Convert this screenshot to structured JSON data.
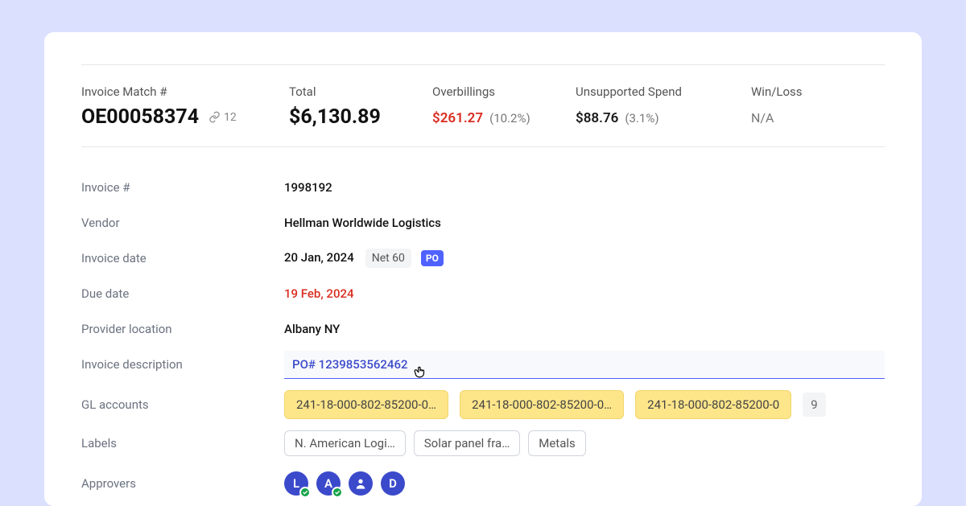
{
  "summary": {
    "match_label": "Invoice Match #",
    "match_number": "OE00058374",
    "match_link_count": "12",
    "total_label": "Total",
    "total_value": "$6,130.89",
    "overbill_label": "Overbillings",
    "overbill_value": "$261.27",
    "overbill_pct": "(10.2%)",
    "unsupported_label": "Unsupported Spend",
    "unsupported_value": "$88.76",
    "unsupported_pct": "(3.1%)",
    "winloss_label": "Win/Loss",
    "winloss_value": "N/A"
  },
  "details": {
    "invoice_num_label": "Invoice #",
    "invoice_num": "1998192",
    "vendor_label": "Vendor",
    "vendor": "Hellman Worldwide Logistics",
    "inv_date_label": "Invoice date",
    "inv_date": "20 Jan, 2024",
    "net_terms": "Net 60",
    "po_tag": "PO",
    "due_label": "Due date",
    "due_date": "19 Feb, 2024",
    "provider_label": "Provider location",
    "provider": "Albany NY",
    "desc_label": "Invoice description",
    "desc_link": "PO# 1239853562462",
    "gl_label": "GL accounts",
    "gl": [
      "241-18-000-802-85200-0…",
      "241-18-000-802-85200-0…",
      "241-18-000-802-85200-0"
    ],
    "gl_more": "9",
    "labels_label": "Labels",
    "labels": [
      "N. American Logi…",
      "Solar panel fra…",
      "Metals"
    ],
    "approvers_label": "Approvers",
    "approvers": [
      "L",
      "A",
      "",
      "D"
    ]
  }
}
